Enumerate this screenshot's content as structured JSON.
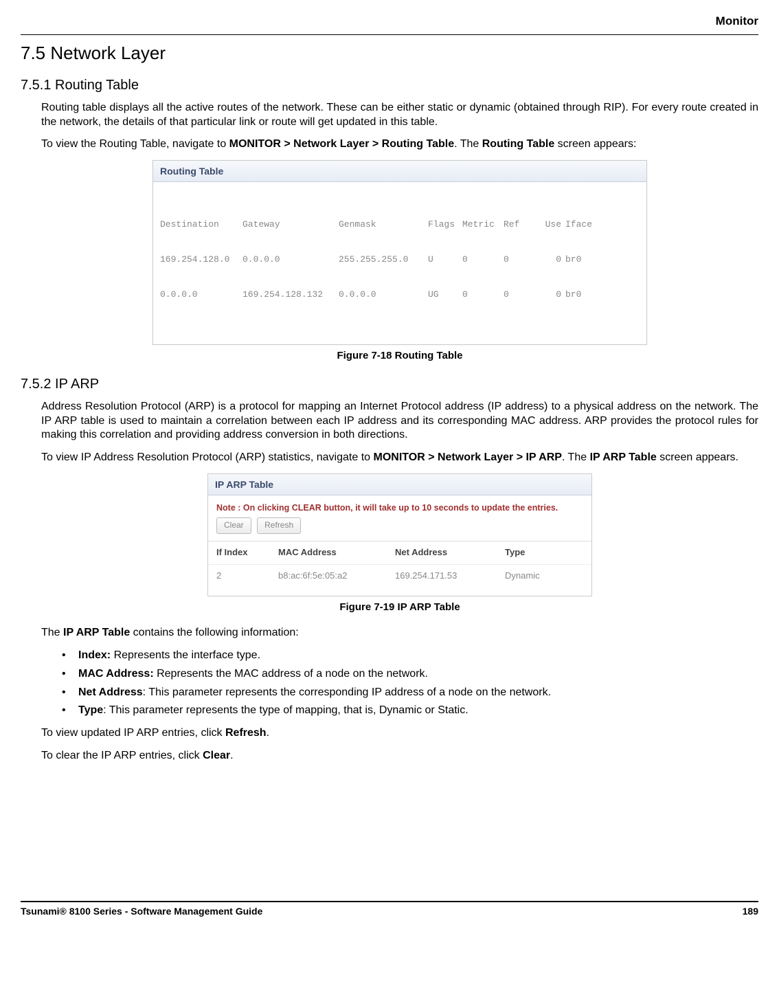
{
  "header": {
    "section": "Monitor"
  },
  "section": {
    "title": "7.5 Network Layer"
  },
  "sub1": {
    "title": "7.5.1 Routing Table",
    "p1": "Routing table displays all the active routes of the network. These can be either static or dynamic (obtained through RIP). For every route created in the network, the details of that particular link or route will get updated in this table.",
    "p2_prefix": "To view the Routing Table, navigate to ",
    "p2_bold1": "MONITOR > Network Layer > Routing Table",
    "p2_mid": ". The ",
    "p2_bold2": "Routing Table",
    "p2_suffix": " screen appears:",
    "caption": "Figure 7-18 Routing Table"
  },
  "routing_panel": {
    "title": "Routing Table",
    "headers": {
      "c1": "Destination",
      "c2": "Gateway",
      "c3": "Genmask",
      "c4": "Flags",
      "c5": "Metric",
      "c6": "Ref",
      "c7": "Use",
      "c8": "Iface"
    },
    "rows": [
      {
        "c1": "169.254.128.0",
        "c2": "0.0.0.0",
        "c3": "255.255.255.0",
        "c4": "U",
        "c5": "0",
        "c6": "0",
        "c7": "0",
        "c8": "br0"
      },
      {
        "c1": "0.0.0.0",
        "c2": "169.254.128.132",
        "c3": "0.0.0.0",
        "c4": "UG",
        "c5": "0",
        "c6": "0",
        "c7": "0",
        "c8": "br0"
      }
    ]
  },
  "sub2": {
    "title": "7.5.2 IP ARP",
    "p1": "Address Resolution Protocol (ARP) is a protocol for mapping an Internet Protocol address (IP address) to a physical address on the network. The IP ARP table is used to maintain a correlation between each IP address and its corresponding MAC address. ARP provides the protocol rules for making this correlation and providing address conversion in both directions.",
    "p2_prefix": "To view IP Address Resolution Protocol (ARP) statistics, navigate to ",
    "p2_bold1": "MONITOR > Network Layer > IP ARP",
    "p2_mid": ". The ",
    "p2_bold2": "IP ARP Table",
    "p2_suffix": " screen appears.",
    "caption": "Figure 7-19 IP ARP Table",
    "p3_prefix": "The ",
    "p3_bold": "IP ARP Table",
    "p3_suffix": " contains the following information:",
    "bullets": [
      {
        "b": "Index:",
        "t": " Represents the interface type."
      },
      {
        "b": "MAC Address:",
        "t": " Represents the MAC address of a node on the network."
      },
      {
        "b": "Net Address",
        "t": ": This parameter represents the corresponding IP address of a node on the network."
      },
      {
        "b": "Type",
        "t": ": This parameter represents the type of mapping, that is, Dynamic or Static."
      }
    ],
    "p4_prefix": "To view updated IP ARP entries, click ",
    "p4_bold": "Refresh",
    "p4_suffix": ".",
    "p5_prefix": "To clear the IP ARP entries, click ",
    "p5_bold": "Clear",
    "p5_suffix": "."
  },
  "arp_panel": {
    "title": "IP ARP Table",
    "note": "Note : On clicking CLEAR button, it will take up to 10 seconds to update the entries.",
    "btn_clear": "Clear",
    "btn_refresh": "Refresh",
    "headers": {
      "c1": "If Index",
      "c2": "MAC Address",
      "c3": "Net Address",
      "c4": "Type"
    },
    "rows": [
      {
        "c1": "2",
        "c2": "b8:ac:6f:5e:05:a2",
        "c3": "169.254.171.53",
        "c4": "Dynamic"
      }
    ]
  },
  "footer": {
    "left": "Tsunami® 8100 Series - Software Management Guide",
    "right": "189"
  }
}
